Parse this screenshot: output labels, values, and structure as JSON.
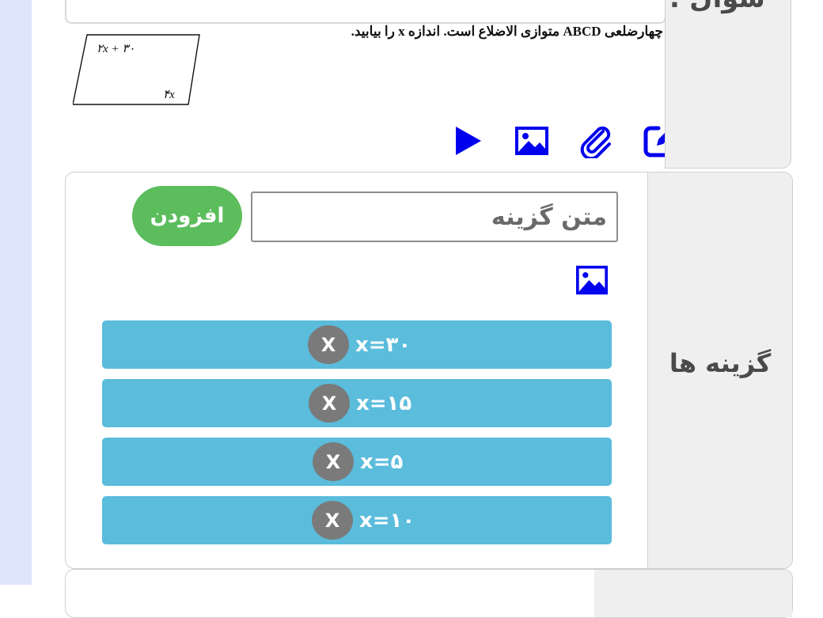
{
  "question": {
    "label": "سوال :",
    "text": "چهارضلعی ABCD متوازی الاضلاع است. اندازه x را بیابید.",
    "figure": {
      "angle_top": "۲x + ۳۰",
      "angle_bottom": "۴x"
    }
  },
  "toolbar": {
    "icons": [
      "play-icon",
      "image-icon",
      "attachment-icon",
      "edit-icon"
    ]
  },
  "options": {
    "label": "گزینه ها",
    "input_placeholder": "متن گزینه",
    "add_label": "افزودن",
    "remove_label": "X",
    "choices": [
      {
        "text": "x=۳۰"
      },
      {
        "text": "x=۱۵"
      },
      {
        "text": "x=۵"
      },
      {
        "text": "x=۱۰"
      }
    ]
  },
  "colors": {
    "choice_bg": "#5bbcdc",
    "add_button": "#5cbd5d",
    "icon_blue": "#0000ee",
    "remove_button": "#7a7a7a"
  }
}
